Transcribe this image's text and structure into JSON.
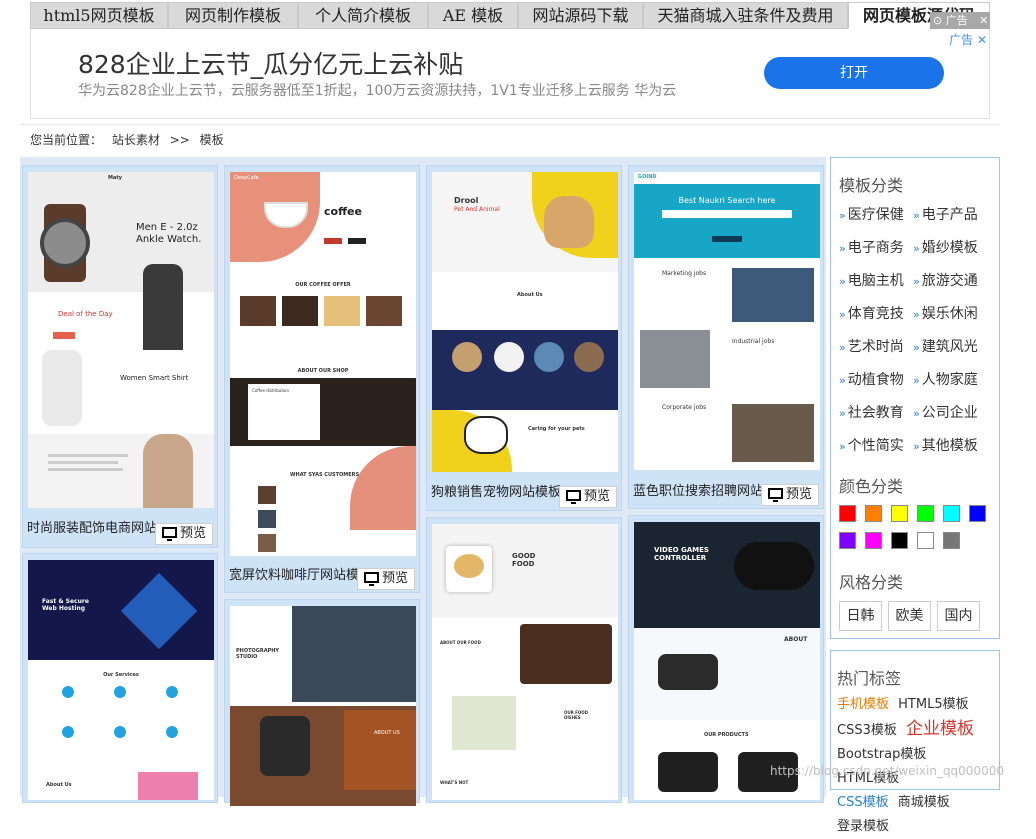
{
  "tabs": [
    "html5网页模板",
    "网页制作模板",
    "个人简介模板",
    "AE 模板",
    "网站源码下载",
    "天猫商城入驻条件及费用",
    "网页模板源代码"
  ],
  "ad": {
    "title": "828企业上云节_瓜分亿元上云补贴",
    "desc": "华为云828企业上云节，云服务器低至1折起，100万云资源扶持，1V1专业迁移上云服务 华为云",
    "button": "打开",
    "label": "广告",
    "close": "✕"
  },
  "breadcrumb": {
    "prefix": "您当前位置：",
    "home": "站长素材",
    "sep": ">>",
    "current": "模板"
  },
  "preview_label": "预览",
  "cards": [
    {
      "title": "时尚服装配饰电商网站"
    },
    {
      "title": "宽屏饮料咖啡厅网站模"
    },
    {
      "title": "狗粮销售宠物网站模板"
    },
    {
      "title": "蓝色职位搜索招聘网站"
    }
  ],
  "shots": {
    "fashion": {
      "brand": "Maty",
      "h1": "Men E - 2.0z",
      "h2": "Ankle Watch.",
      "deal": "Deal of the Day",
      "shirt": "Women Smart Shirt"
    },
    "coffee": {
      "brand": "DeepCafe",
      "hero": "coffee",
      "offer": "OUR COFFEE OFFER",
      "shop": "ABOUT OUR SHOP",
      "dist": "Coffee distribution",
      "says": "WHAT SYAS CUSTOMERS"
    },
    "dog": {
      "hero1": "Drool",
      "hero2": "Pet And Animal",
      "about": "About Us",
      "caring": "Caring for your pets"
    },
    "jobs": {
      "brand": "GOIND",
      "hero": "Best Naukri Search here",
      "s1": "Marketing jobs",
      "s2": "Industrial jobs",
      "s3": "Corporate jobs"
    },
    "hosting": {
      "title": "Fast & Secure Web Hosting",
      "services": "Our Services",
      "about": "About Us"
    },
    "photo": {
      "title": "PHOTOGRAPHY STUDIO",
      "about": "ABOUT US"
    },
    "food": {
      "title": "GOOD FOOD",
      "about": "ABOUT OUR FOOD",
      "dishes": "OUR FOOD DISHES",
      "whats": "WHAT'S NOT"
    },
    "games": {
      "title": "VIDEO GAMES CONTROLLER",
      "about": "ABOUT",
      "products": "OUR PRODUCTS"
    }
  },
  "sidebar": {
    "cat_title": "模板分类",
    "categories": [
      "医疗保健",
      "电子产品",
      "电子商务",
      "婚纱模板",
      "电脑主机",
      "旅游交通",
      "体育竞技",
      "娱乐休闲",
      "艺术时尚",
      "建筑风光",
      "动植食物",
      "人物家庭",
      "社会教育",
      "公司企业",
      "个性简实",
      "其他模板"
    ],
    "color_title": "颜色分类",
    "colors": [
      "#ff0000",
      "#ff7f00",
      "#ffff00",
      "#00ff00",
      "#00ffff",
      "#0000ff",
      "#8000ff",
      "#ff00ff",
      "#000000",
      "#ffffff",
      "#777777"
    ],
    "style_title": "风格分类",
    "styles": [
      "日韩",
      "欧美",
      "国内"
    ],
    "hot_title": "热门标签",
    "tags": [
      {
        "text": "手机模板",
        "color": "#e07b00"
      },
      {
        "text": "HTML5模板",
        "color": "#333333"
      },
      {
        "text": "CSS3模板",
        "color": "#333333"
      },
      {
        "text": "企业模板",
        "color": "#d9342b"
      },
      {
        "text": "Bootstrap模板",
        "color": "#333333"
      },
      {
        "text": "HTML模板",
        "color": "#333333"
      },
      {
        "text": "CSS模板",
        "color": "#2a7fd4"
      },
      {
        "text": "商城模板",
        "color": "#333333"
      },
      {
        "text": "登录模板",
        "color": "#333333"
      }
    ]
  },
  "watermark": "https://blog.csdn.net/weixin_qq000000"
}
